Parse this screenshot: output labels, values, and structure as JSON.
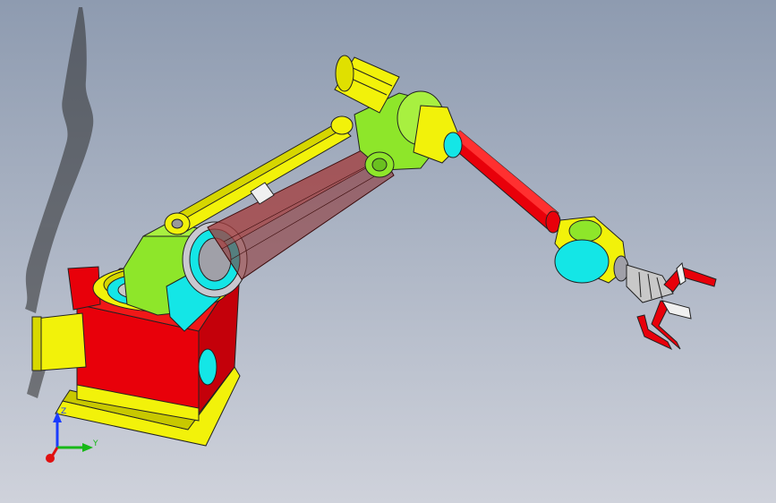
{
  "viewport": {
    "background_top": "#8e9bb0",
    "background_bottom": "#cfd2db"
  },
  "triad": {
    "z_label": "Z",
    "y_label": "Y",
    "z_color": "#1a3cff",
    "y_color": "#18b818",
    "x_color": "#e01010"
  },
  "model": {
    "colors": {
      "red": "#e8000a",
      "yellow": "#f2f20a",
      "lime": "#8ee62a",
      "cyan": "#14e6e6",
      "maroon_translucent": "#8a2a2a",
      "dark_shadow": "#2a2a2a"
    },
    "icons": [
      "robot-base",
      "shoulder-joint",
      "upper-arm",
      "link-rod",
      "elbow-joint",
      "forearm",
      "wrist",
      "gripper",
      "floor-shadow"
    ]
  }
}
